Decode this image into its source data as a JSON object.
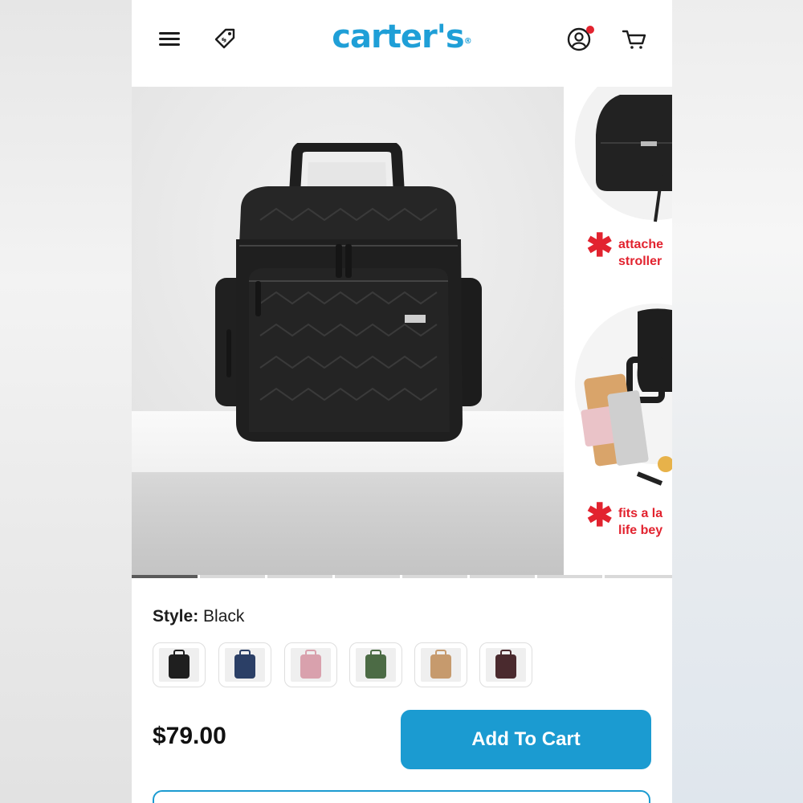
{
  "header": {
    "logo_text": "carter's",
    "logo_mark": "®",
    "icons": [
      "menu-icon",
      "sale-tag-icon",
      "account-icon",
      "cart-icon"
    ],
    "brand_color": "#1f9fd7",
    "notification_color": "#e2232f"
  },
  "gallery": {
    "next_slide": {
      "callouts": [
        {
          "line1": "attache",
          "line2": "stroller"
        },
        {
          "line1": "fits a la",
          "line2": "life bey"
        }
      ]
    },
    "dots_count": 8,
    "active_index": 0
  },
  "product": {
    "style_label": "Style:",
    "style_value": "Black",
    "swatches": [
      {
        "name": "Black",
        "color": "#1f1f1f"
      },
      {
        "name": "Navy",
        "color": "#2b3f66"
      },
      {
        "name": "Pink",
        "color": "#d9a1ad"
      },
      {
        "name": "Green",
        "color": "#4c6b45"
      },
      {
        "name": "Tan",
        "color": "#c69a6d"
      },
      {
        "name": "Burgundy",
        "color": "#4a2a2e"
      }
    ],
    "price": "$79.00",
    "add_to_cart_label": "Add To Cart",
    "accent_color": "#1b9bd1"
  }
}
